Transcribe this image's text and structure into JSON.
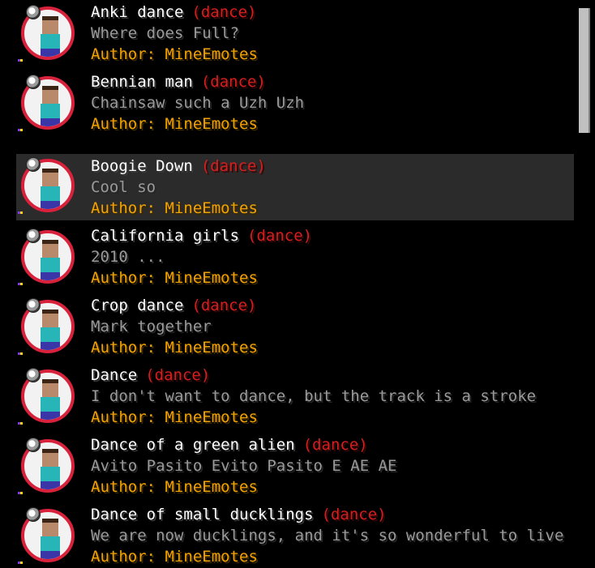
{
  "emotes": [
    {
      "title": "Anki dance",
      "tag": "(dance)",
      "description": "Where does Full?",
      "author": "Author: MineEmotes"
    },
    {
      "title": "Bennian man",
      "tag": "(dance)",
      "description": "Chainsaw such a Uzh Uzh",
      "author": "Author: MineEmotes"
    },
    {
      "title": "Boogie Down",
      "tag": "(dance)",
      "description": "Cool so",
      "author": "Author: MineEmotes"
    },
    {
      "title": "California girls",
      "tag": "(dance)",
      "description": "2010 ...",
      "author": "Author: MineEmotes"
    },
    {
      "title": "Crop dance",
      "tag": "(dance)",
      "description": "Mark together",
      "author": "Author: MineEmotes"
    },
    {
      "title": "Dance",
      "tag": "(dance)",
      "description": "I don't want to dance, but the track is a stroke",
      "author": "Author: MineEmotes"
    },
    {
      "title": "Dance of a green alien",
      "tag": "(dance)",
      "description": "Avito Pasito Evito Pasito E AE AE",
      "author": "Author: MineEmotes"
    },
    {
      "title": "Dance of small ducklings",
      "tag": "(dance)",
      "description": "We are now ducklings, and it's so wonderful to live",
      "author": "Author: MineEmotes"
    }
  ],
  "selected_index": 2,
  "icons": {
    "thumbnail": "steve-dance-icon",
    "disco": "disco-ball-icon"
  },
  "colors": {
    "title": "#ffffff",
    "tag": "#d41f1f",
    "description": "#9a9a9a",
    "author": "#f2a300",
    "ring": "#d8213a",
    "selected_row": "#2b2b2b"
  }
}
